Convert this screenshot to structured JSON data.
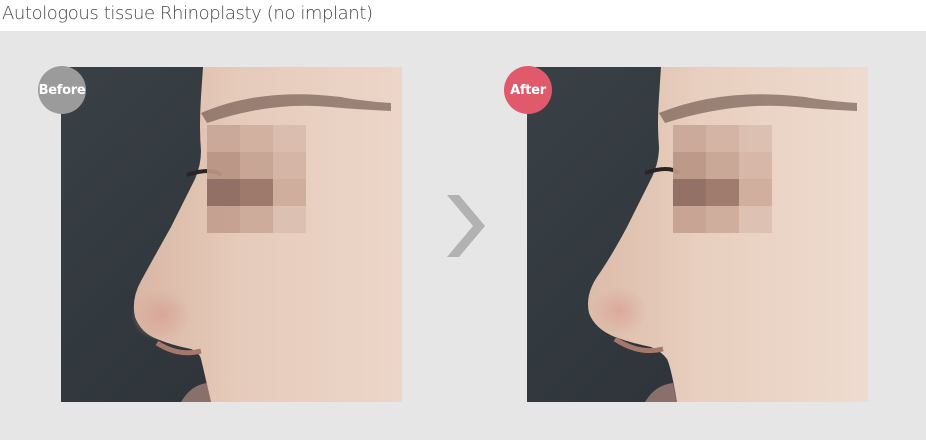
{
  "title": "Autologous tissue Rhinoplasty (no implant)",
  "before": {
    "badge_label": "Before",
    "badge_color": "#9b9b9b",
    "image_description_icon": "face-profile-photo"
  },
  "after": {
    "badge_label": "After",
    "badge_color": "#e15a6b",
    "image_description_icon": "face-profile-photo"
  },
  "arrow_icon": "chevron-right-icon",
  "colors": {
    "stage_background": "#e6e6e6",
    "photo_background": "#2f353a",
    "skin": "#e2c6b6",
    "arrow": "#b2b2b2"
  }
}
